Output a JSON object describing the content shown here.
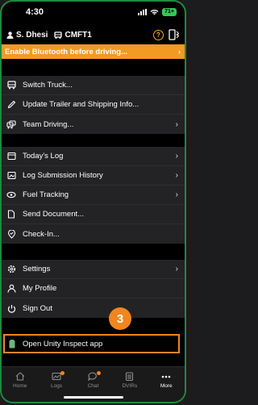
{
  "status": {
    "time": "4:30",
    "battery": "71+"
  },
  "header": {
    "user": "S. Dhesi",
    "truck": "CMFT1"
  },
  "banner": {
    "text": "Enable Bluetooth before driving..."
  },
  "section1": [
    {
      "label": "Switch Truck...",
      "icon": "truck-icon",
      "chevron": false
    },
    {
      "label": "Update Trailer and Shipping Info...",
      "icon": "pencil-icon",
      "chevron": false
    },
    {
      "label": "Team Driving...",
      "icon": "team-icon",
      "chevron": true
    }
  ],
  "section2": [
    {
      "label": "Today's Log",
      "icon": "log-icon",
      "chevron": true
    },
    {
      "label": "Log Submission History",
      "icon": "history-icon",
      "chevron": true
    },
    {
      "label": "Fuel Tracking",
      "icon": "fuel-icon",
      "chevron": true
    },
    {
      "label": "Send Document...",
      "icon": "document-icon",
      "chevron": false
    },
    {
      "label": "Check-In...",
      "icon": "check-in-icon",
      "chevron": false
    }
  ],
  "section3": [
    {
      "label": "Settings",
      "icon": "gear-icon",
      "chevron": true
    },
    {
      "label": "My Profile",
      "icon": "profile-icon",
      "chevron": false
    },
    {
      "label": "Sign Out",
      "icon": "power-icon",
      "chevron": false
    }
  ],
  "step_badge": "3",
  "unity": {
    "label": "Open Unity Inspect app"
  },
  "tabs": [
    {
      "label": "Home",
      "icon": "home-icon",
      "active": false,
      "dot": false
    },
    {
      "label": "Logs",
      "icon": "logs-icon",
      "active": false,
      "dot": true
    },
    {
      "label": "Chat",
      "icon": "chat-icon",
      "active": false,
      "dot": true
    },
    {
      "label": "DVIRs",
      "icon": "dvirs-icon",
      "active": false,
      "dot": false
    },
    {
      "label": "More",
      "icon": "more-icon",
      "active": true,
      "dot": false
    }
  ],
  "colors": {
    "accent": "#f0861f",
    "banner": "#f39a24",
    "battery": "#34c759",
    "frame": "#1f8a3c"
  }
}
